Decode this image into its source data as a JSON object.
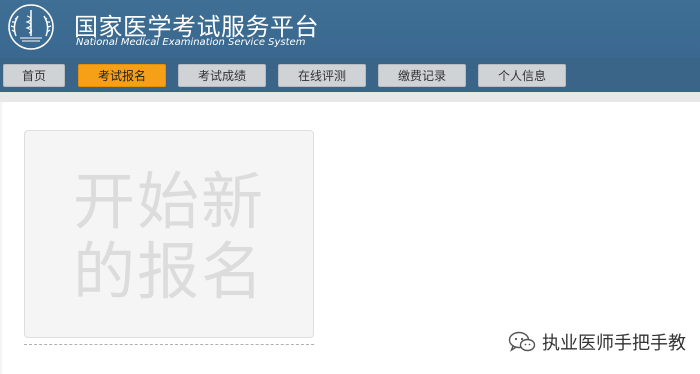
{
  "header": {
    "title_cn": "国家医学考试服务平台",
    "title_en": "National Medical Examination Service System",
    "logo_icon": "medical-emblem-icon"
  },
  "nav": {
    "items": [
      {
        "label": "首页",
        "active": false
      },
      {
        "label": "考试报名",
        "active": true
      },
      {
        "label": "考试成绩",
        "active": false
      },
      {
        "label": "在线评测",
        "active": false
      },
      {
        "label": "缴费记录",
        "active": false
      },
      {
        "label": "个人信息",
        "active": false
      }
    ]
  },
  "main": {
    "new_registration_label": "开始新的报名"
  },
  "watermark": {
    "icon": "wechat-icon",
    "text": "执业医师手把手教"
  },
  "colors": {
    "header_bg": "#3f6f95",
    "nav_bg": "#3a6488",
    "active_tab": "#f5a016"
  }
}
